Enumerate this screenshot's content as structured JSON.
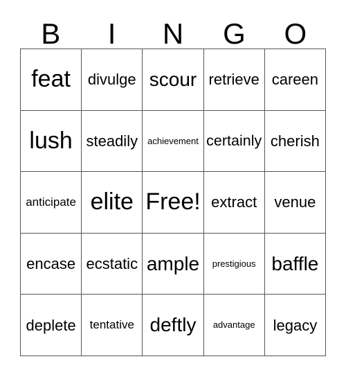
{
  "card": {
    "type": "bingo-card",
    "header_letters": [
      "B",
      "I",
      "N",
      "G",
      "O"
    ],
    "columns": 5,
    "rows": 5,
    "free_space": {
      "row": 2,
      "col": 2,
      "label": "Free!"
    },
    "colors": {
      "background": "#ffffff",
      "text": "#000000",
      "grid_line": "#555555"
    },
    "rows_data": [
      {
        "cells": [
          {
            "text": "feat",
            "size": "fs-xl"
          },
          {
            "text": "divulge",
            "size": "fs-md"
          },
          {
            "text": "scour",
            "size": "fs-lg"
          },
          {
            "text": "retrieve",
            "size": "fs-md"
          },
          {
            "text": "careen",
            "size": "fs-md"
          }
        ]
      },
      {
        "cells": [
          {
            "text": "lush",
            "size": "fs-xl"
          },
          {
            "text": "steadily",
            "size": "fs-md"
          },
          {
            "text": "achievement",
            "size": "fs-xs"
          },
          {
            "text": "certainly",
            "size": "fs-md"
          },
          {
            "text": "cherish",
            "size": "fs-md"
          }
        ]
      },
      {
        "cells": [
          {
            "text": "anticipate",
            "size": "fs-sm"
          },
          {
            "text": "elite",
            "size": "fs-xl"
          },
          {
            "text": "Free!",
            "size": "fs-xl"
          },
          {
            "text": "extract",
            "size": "fs-md"
          },
          {
            "text": "venue",
            "size": "fs-md"
          }
        ]
      },
      {
        "cells": [
          {
            "text": "encase",
            "size": "fs-md"
          },
          {
            "text": "ecstatic",
            "size": "fs-md"
          },
          {
            "text": "ample",
            "size": "fs-lg"
          },
          {
            "text": "prestigious",
            "size": "fs-xs"
          },
          {
            "text": "baffle",
            "size": "fs-lg"
          }
        ]
      },
      {
        "cells": [
          {
            "text": "deplete",
            "size": "fs-md"
          },
          {
            "text": "tentative",
            "size": "fs-sm"
          },
          {
            "text": "deftly",
            "size": "fs-lg"
          },
          {
            "text": "advantage",
            "size": "fs-xs"
          },
          {
            "text": "legacy",
            "size": "fs-md"
          }
        ]
      }
    ]
  }
}
